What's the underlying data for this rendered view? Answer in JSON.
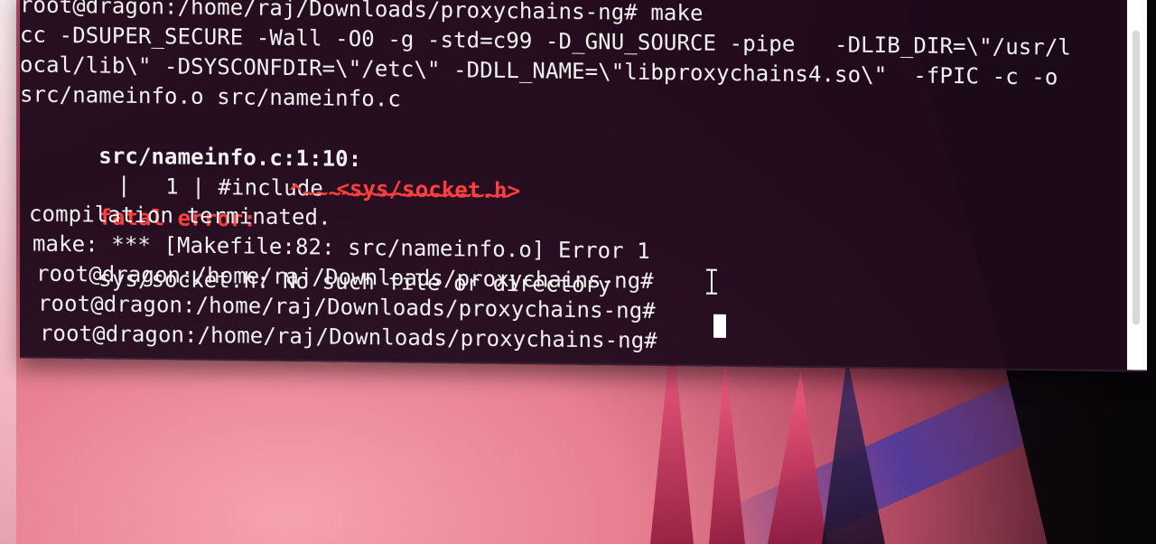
{
  "terminal": {
    "lines": [
      "root@dragon:/home/raj/Downloads/proxychains-ng# make",
      "cc -DSUPER_SECURE -Wall -O0 -g -std=c99 -D_GNU_SOURCE -pipe   -DLIB_DIR=\\\"/usr/l",
      "ocal/lib\\\" -DSYSCONFDIR=\\\"/etc\\\" -DDLL_NAME=\\\"libproxychains4.so\\\"  -fPIC -c -o",
      "src/nameinfo.o src/nameinfo.c",
      "compilation terminated.",
      "make: *** [Makefile:82: src/nameinfo.o] Error 1",
      "root@dragon:/home/raj/Downloads/proxychains-ng#",
      "root@dragon:/home/raj/Downloads/proxychains-ng#",
      "root@dragon:/home/raj/Downloads/proxychains-ng#"
    ],
    "error_location": "src/nameinfo.c:1:10:",
    "error_label": "fatal error:",
    "error_message": "sys/socket.h: No such file or directory",
    "include_line_prefix": "1 | #include ",
    "include_header": "<sys/socket.h>",
    "caret_text": "^~~~~~~~~~~~~~~~~",
    "continuation_bar": "|"
  },
  "icons": {
    "text_cursor": "i-beam-icon",
    "terminal_cursor": "block-cursor-icon"
  },
  "colors": {
    "error_red": "#ff3f3f",
    "terminal_bg": "#1e0a1c",
    "terminal_text": "#f2f2f2"
  }
}
